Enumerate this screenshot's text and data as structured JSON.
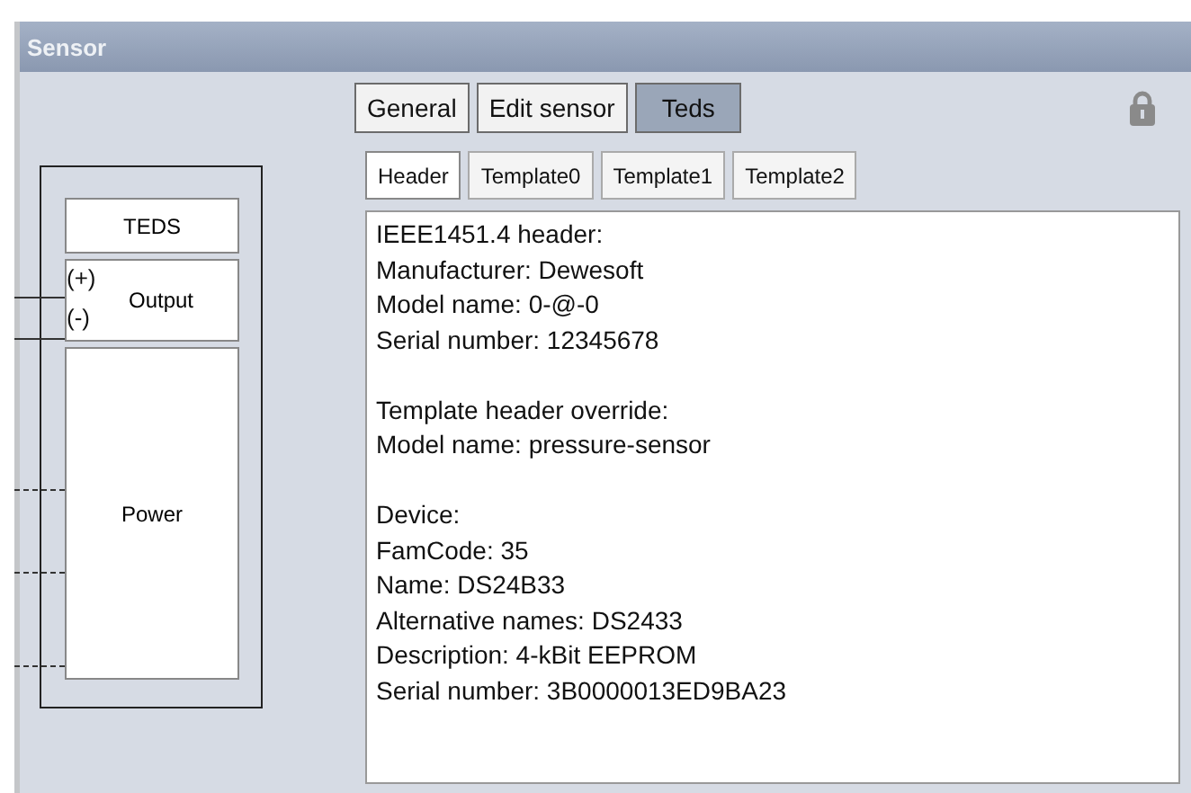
{
  "window": {
    "title": "Sensor"
  },
  "tabs": [
    {
      "label": "General",
      "selected": false
    },
    {
      "label": "Edit sensor",
      "selected": false
    },
    {
      "label": "Teds",
      "selected": true
    }
  ],
  "locked": true,
  "sub_tabs": [
    {
      "label": "Header",
      "selected": true
    },
    {
      "label": "Template0",
      "selected": false
    },
    {
      "label": "Template1",
      "selected": false
    },
    {
      "label": "Template2",
      "selected": false
    }
  ],
  "diagram": {
    "teds": "TEDS",
    "output": "Output",
    "plus": "(+)",
    "minus": "(-)",
    "power": "Power"
  },
  "info": [
    [
      "IEEE1451.4 header:",
      "Manufacturer: Dewesoft",
      "Model name: 0-@-0",
      "Serial number: 12345678"
    ],
    [
      "Template header override:",
      "Model name: pressure-sensor"
    ],
    [
      "Device:",
      "FamCode: 35",
      "Name: DS24B33",
      "Alternative names: DS2433",
      "Description: 4-kBit EEPROM",
      "Serial number: 3B0000013ED9BA23"
    ]
  ]
}
